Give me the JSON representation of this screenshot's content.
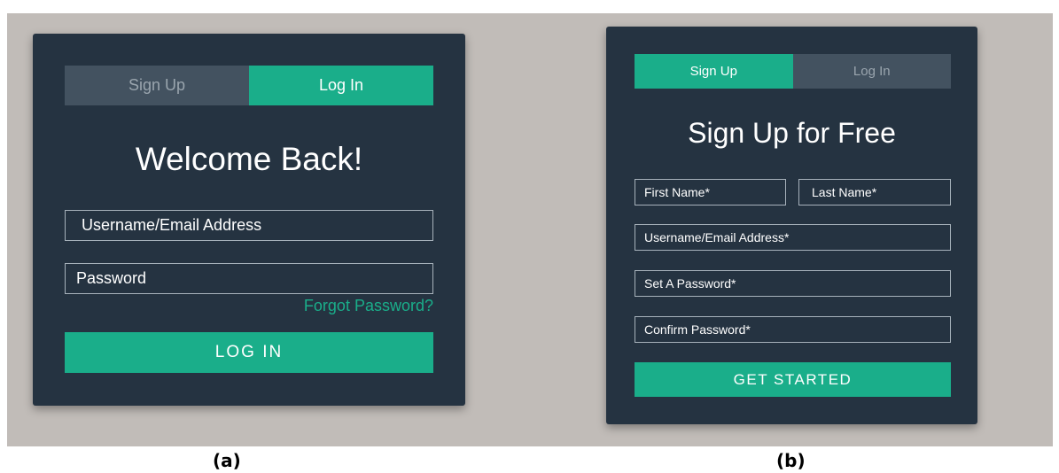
{
  "login_panel": {
    "tabs": [
      {
        "label": "Sign Up",
        "active": false
      },
      {
        "label": "Log In",
        "active": true
      }
    ],
    "heading": "Welcome Back!",
    "fields": {
      "username_placeholder": "Username/Email Address",
      "password_placeholder": "Password"
    },
    "forgot_password_link": "Forgot Password?",
    "submit_label": "LOG IN"
  },
  "signup_panel": {
    "tabs": [
      {
        "label": "Sign Up",
        "active": true
      },
      {
        "label": "Log In",
        "active": false
      }
    ],
    "heading": "Sign Up for Free",
    "fields": {
      "first_name_placeholder": "First Name*",
      "last_name_placeholder": "Last Name*",
      "username_placeholder": "Username/Email Address*",
      "password_placeholder": "Set A Password*",
      "confirm_password_placeholder": "Confirm Password*"
    },
    "submit_label": "GET STARTED"
  },
  "captions": {
    "a": "(a)",
    "b": "(b)"
  },
  "colors": {
    "panel_background": "#253341",
    "accent": "#1aae8a",
    "inactive_tab": "#435260",
    "page_background": "#c1bcb8"
  }
}
